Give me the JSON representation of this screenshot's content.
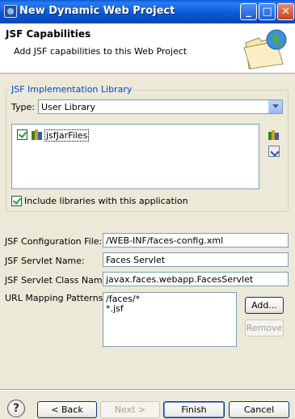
{
  "window": {
    "title": "New Dynamic Web Project"
  },
  "header": {
    "title": "JSF Capabilities",
    "description": "Add JSF capabilities to this Web Project"
  },
  "group": {
    "legend": "JSF Implementation Library",
    "type_label": "Type:",
    "type_value": "User Library",
    "libraries": [
      "jsfJarFiles"
    ],
    "include_label": "Include libraries with this application"
  },
  "fields": {
    "config_label": "JSF Configuration File:",
    "config_value": "/WEB-INF/faces-config.xml",
    "servlet_name_label": "JSF Servlet Name:",
    "servlet_name_value": "Faces Servlet",
    "servlet_class_label": "JSF Servlet Class Name:",
    "servlet_class_value": "javax.faces.webapp.FacesServlet",
    "url_label": "URL Mapping Patterns:",
    "url_patterns": [
      "/faces/*",
      "*.jsf"
    ]
  },
  "buttons": {
    "add": "Add...",
    "remove": "Remove",
    "back": "< Back",
    "next": "Next >",
    "finish": "Finish",
    "cancel": "Cancel"
  },
  "colors": {
    "titlebar": "#0b58d5",
    "dialog_bg": "#ece9d8",
    "group_legend": "#0046d5"
  },
  "icons": [
    "app-icon",
    "minimize-icon",
    "maximize-icon",
    "close-icon",
    "wizard-folder-globe-icon",
    "library-icon",
    "add-library-icon",
    "download-library-icon",
    "help-icon"
  ]
}
